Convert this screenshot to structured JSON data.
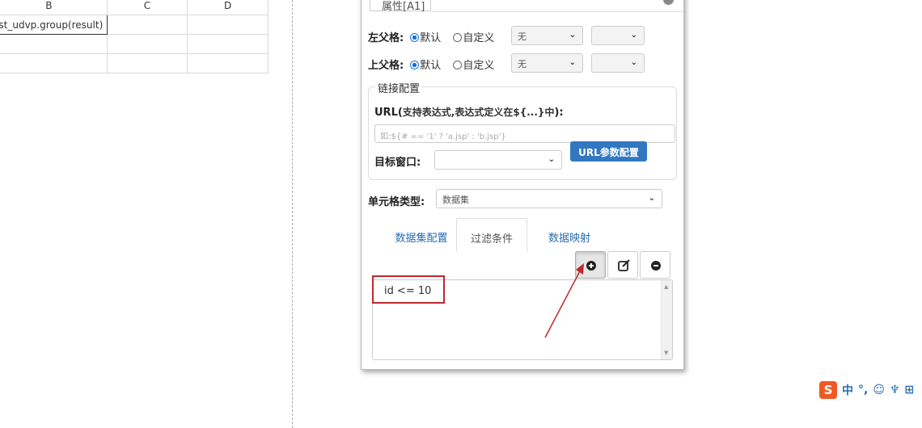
{
  "sheet": {
    "col_headers": [
      "B",
      "C",
      "D"
    ],
    "selected_cell_value": "est_udvp.group(result)"
  },
  "panel": {
    "tab_label": "属性[A1]",
    "left_parent": {
      "label": "左父格:",
      "default_label": "默认",
      "custom_label": "自定义",
      "select_value": "无",
      "select2_value": ""
    },
    "top_parent": {
      "label": "上父格:",
      "default_label": "默认",
      "custom_label": "自定义",
      "select_value": "无",
      "select2_value": ""
    },
    "link": {
      "legend": "链接配置",
      "url_label_bold": "URL(",
      "url_label_hint": "支持表达式,表达式定义在${...}中",
      "url_label_end": "):",
      "url_placeholder": "如:${# == '1' ? 'a.jsp' : 'b.jsp'}",
      "target_label": "目标窗口:",
      "target_value": "",
      "url_params_button": "URL参数配置"
    },
    "cell_type": {
      "label": "单元格类型:",
      "value": "数据集"
    },
    "tabs": [
      "数据集配置",
      "过滤条件",
      "数据映射"
    ],
    "active_tab": "过滤条件",
    "filters": [
      "id <= 10"
    ]
  },
  "ime": {
    "logo": "S",
    "items": [
      "中",
      "°,",
      "☺",
      "♆",
      "⊞"
    ]
  },
  "colors": {
    "accent_blue": "#3278c0",
    "highlight_red": "#c0282d",
    "radio_blue": "#1e73d8"
  }
}
